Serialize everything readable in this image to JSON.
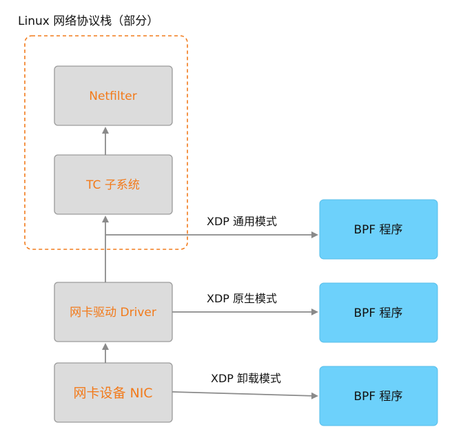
{
  "group": {
    "title": "Linux 网络协议栈（部分）"
  },
  "nodes": {
    "netfilter": "Netfilter",
    "tc": "TC 子系统",
    "driver": "网卡驱动 Driver",
    "nic": "网卡设备 NIC",
    "bpf_generic": "BPF 程序",
    "bpf_native": "BPF 程序",
    "bpf_offload": "BPF 程序"
  },
  "edges": {
    "xdp_generic": "XDP 通用模式",
    "xdp_native": "XDP 原生模式",
    "xdp_offload": "XDP 卸载模式"
  },
  "colors": {
    "accent_orange": "#f27a1a",
    "node_gray": "#dcdcdc",
    "bpf_blue": "#6dd1fb",
    "arrow_gray": "#8a8a8a"
  }
}
